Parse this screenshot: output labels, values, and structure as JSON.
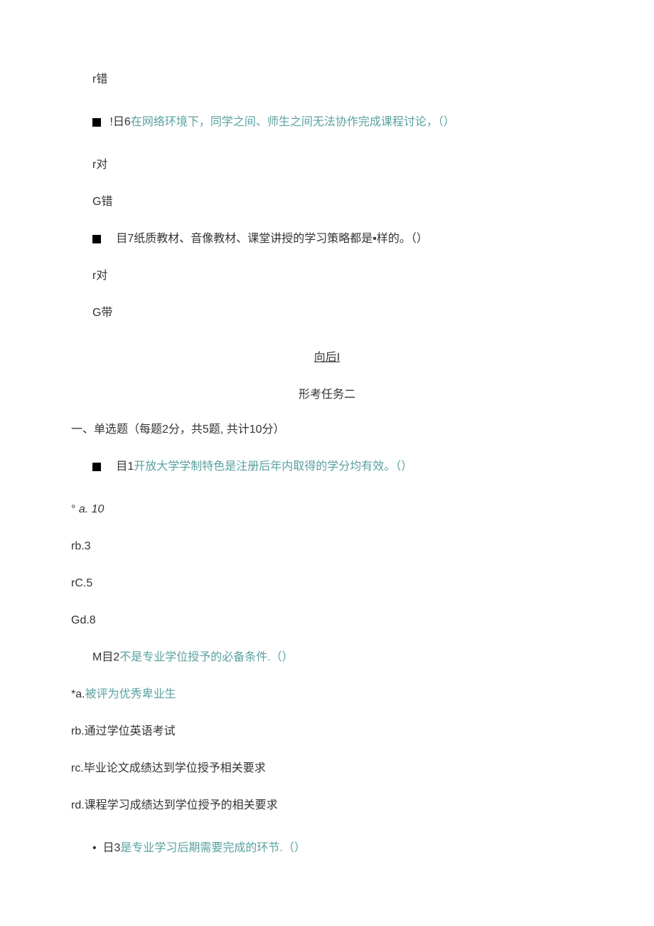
{
  "q5_wrong": "r错",
  "q6": {
    "prefix": "!日6",
    "text": "在网络环境下，同学之间、师生之间无法协作完成课程讨论，（）",
    "opt_true": "r对",
    "opt_false": "G错"
  },
  "q7": {
    "prefix": "目7",
    "text": "纸质教材、音像教材、课堂讲授的学习策略都是•样的。（）",
    "opt_true": "r对",
    "opt_false": "G带"
  },
  "nav": "向后I",
  "task2": {
    "title": "形考任务二",
    "section": "一、单选题（每题2分，共5题, 共计10分）"
  },
  "t2q1": {
    "prefix": "目1",
    "text": "开放大学学制特色是注册后年内取得的学分均有效。（）",
    "a_prefix": "° ",
    "a": "a. 10",
    "b": "rb.3",
    "c": "rC.5",
    "d": "Gd.8"
  },
  "t2q2": {
    "prefix": "M目2",
    "text": "不是专业学位授予的必备条件.（）",
    "a": "*a.被评为优秀卑业生",
    "b": "rb.通过学位英语考试",
    "c": "rc.毕业论文成绩达到学位授予相关要求",
    "d": "rd.课程学习成绩达到学位授予的相关要求"
  },
  "t2q3": {
    "prefix": "日3",
    "text": "是专业学习后期需要完成的环节.（）"
  }
}
